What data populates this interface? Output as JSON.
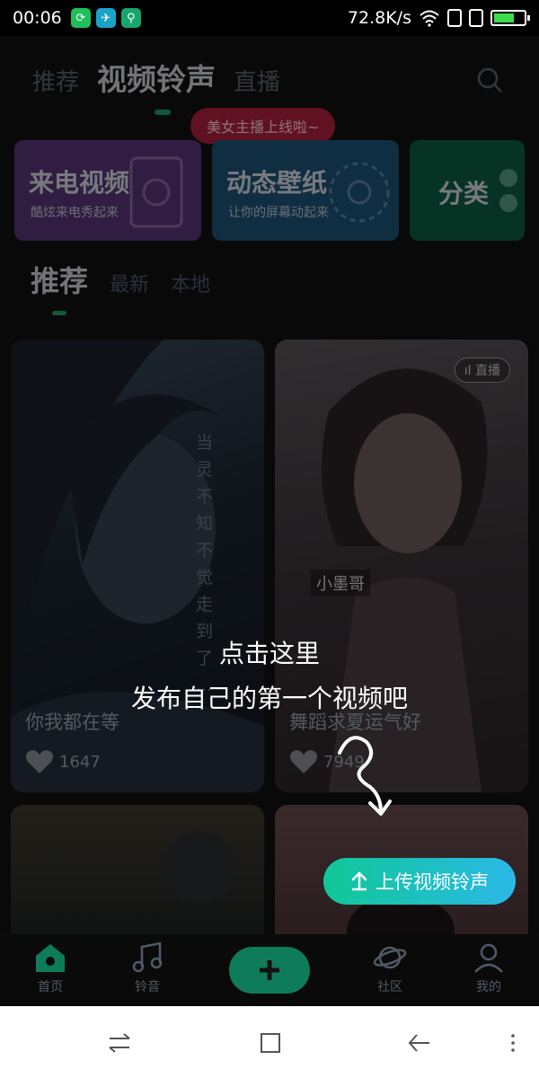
{
  "status_bar": {
    "time": "00:06",
    "net_speed": "72.8K/s",
    "battery_fraction": 0.7
  },
  "header": {
    "tabs": [
      "推荐",
      "视频铃声",
      "直播"
    ],
    "active_tab": "视频铃声",
    "promo_pill": "美女主播上线啦~"
  },
  "category_cards": [
    {
      "title": "来电视频",
      "subtitle": "酷炫来电秀起来",
      "color": "#6a3a86"
    },
    {
      "title": "动态壁纸",
      "subtitle": "让你的屏幕动起来",
      "color": "#1d5f85"
    },
    {
      "title": "分类",
      "subtitle": "",
      "color": "#0e6b4a"
    }
  ],
  "sub_tabs": [
    "推荐",
    "最新",
    "本地"
  ],
  "videos": [
    {
      "caption": "你我都在等",
      "likes": "1647",
      "vertical_text": "当 灵 不 知 不 觉 走 到 了 ...",
      "live": ""
    },
    {
      "caption": "舞蹈求夏运气好",
      "likes": "7949",
      "vertical_text": "",
      "live": "直播",
      "watermark": "小墨哥"
    }
  ],
  "guide": {
    "line1": "点击这里",
    "line2": "发布自己的第一个视频吧"
  },
  "upload_button": {
    "label": "上传视频铃声"
  },
  "bottom_nav": [
    "首页",
    "铃音",
    "社区",
    "我的"
  ],
  "colors": {
    "accent_green": "#1fa06a",
    "upload_gradient_start": "#10c896",
    "upload_gradient_end": "#2bb8e8"
  }
}
